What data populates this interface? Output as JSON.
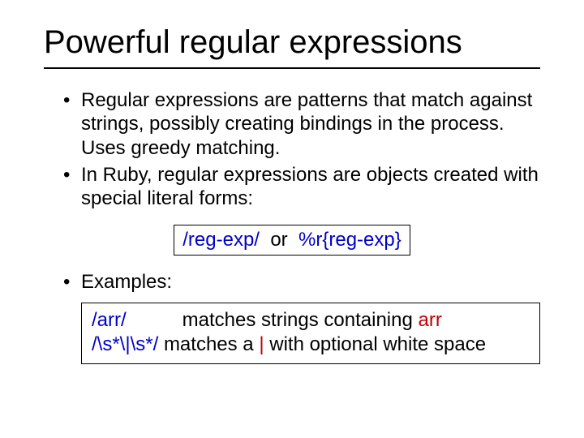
{
  "title": "Powerful regular expressions",
  "bullets": {
    "b1": "Regular expressions are patterns that match against strings, possibly creating bindings in the process.  Uses greedy matching.",
    "b2": "In Ruby, regular expressions are objects created with special literal forms:",
    "b3": "Examples:"
  },
  "syntax": {
    "form1": "/reg-exp/",
    "sep": "or",
    "form2": "%r{reg-exp}"
  },
  "examples": {
    "e1_pat": "/arr/",
    "e1_desc_a": "matches strings containing ",
    "e1_desc_b": "arr",
    "e2_pat": "/\\s*\\|\\s*/",
    "e2_desc_a": "matches a ",
    "e2_desc_b": "|",
    "e2_desc_c": " with optional white space"
  }
}
